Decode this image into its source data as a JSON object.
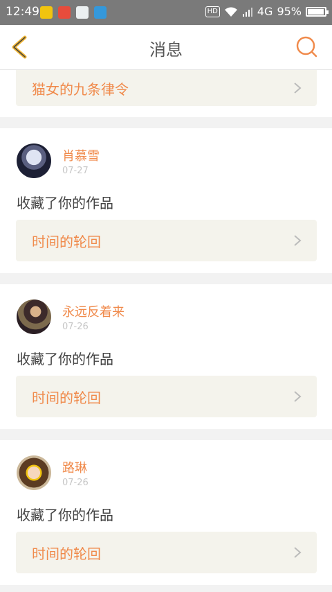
{
  "status_bar": {
    "time": "12:49",
    "hd": "HD",
    "network": "4G",
    "battery": "95%",
    "battery_level": 0.95
  },
  "header": {
    "title": "消息",
    "back_icon": "chevron-left-icon",
    "search_icon": "search-icon",
    "accent_color": "#f0b430"
  },
  "top_card": {
    "work_title": "猫女的九条律令"
  },
  "messages": [
    {
      "user": "肖慕雪",
      "date": "07-27",
      "action": "收藏了你的作品",
      "work_title": "时间的轮回"
    },
    {
      "user": "永远反着来",
      "date": "07-26",
      "action": "收藏了你的作品",
      "work_title": "时间的轮回"
    },
    {
      "user": "路琳",
      "date": "07-26",
      "action": "收藏了你的作品",
      "work_title": "时间的轮回"
    }
  ],
  "colors": {
    "orange": "#f08a4b",
    "link_bg": "#f4f3ec"
  }
}
